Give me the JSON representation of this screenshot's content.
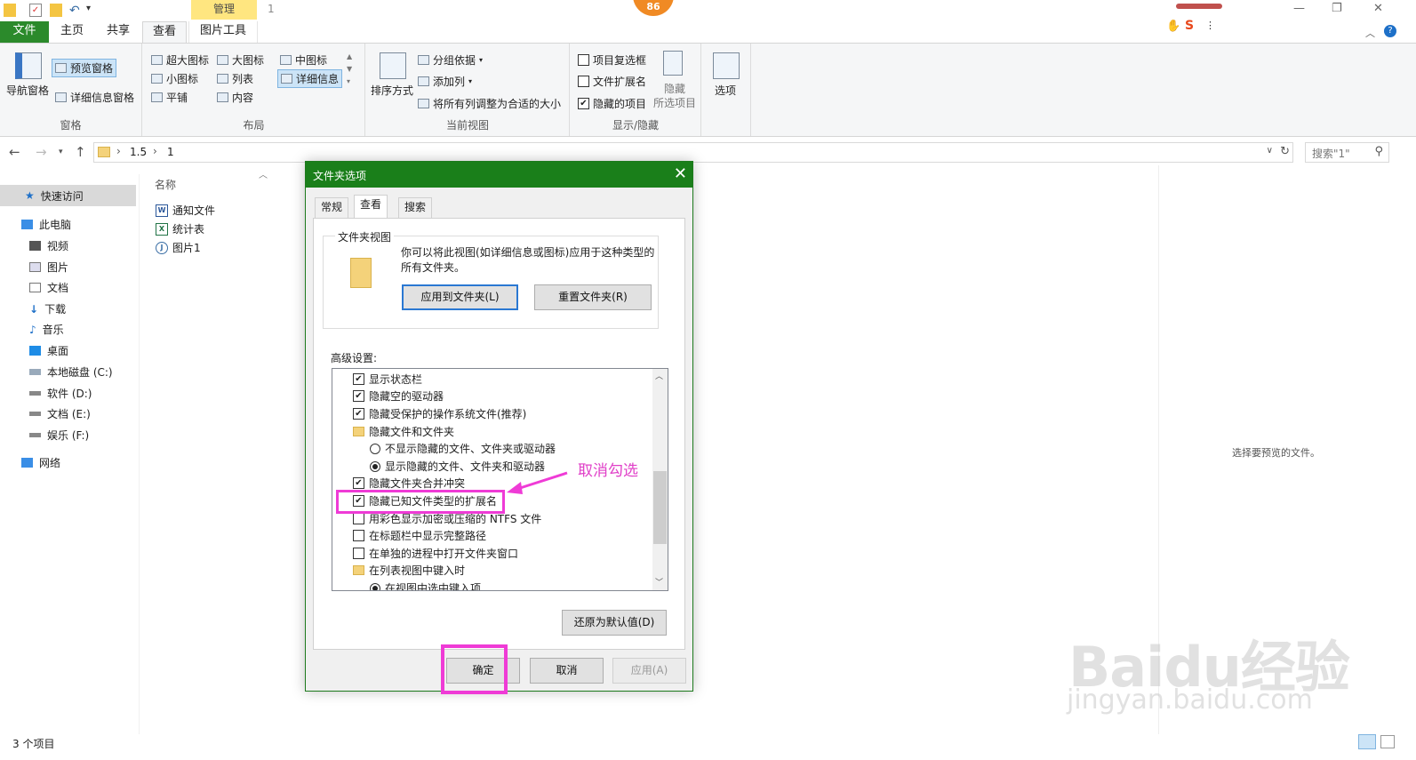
{
  "titlebar": {
    "manage_tab": "管理",
    "window_title": "1",
    "badge": "86",
    "minimize": "—",
    "maximize": "❐",
    "close": "✕"
  },
  "ribbon_tabs": {
    "file": "文件",
    "home": "主页",
    "share": "共享",
    "view": "查看",
    "picture_tools": "图片工具"
  },
  "ribbon": {
    "panes": {
      "label": "窗格",
      "nav_pane": "导航窗格",
      "preview_pane": "预览窗格",
      "details_pane": "详细信息窗格"
    },
    "layout": {
      "label": "布局",
      "extra_large": "超大图标",
      "large": "大图标",
      "medium": "中图标",
      "small": "小图标",
      "list": "列表",
      "details": "详细信息",
      "tiles": "平铺",
      "content": "内容"
    },
    "current_view": {
      "label": "当前视图",
      "sort_by": "排序方式",
      "group_by": "分组依据",
      "add_columns": "添加列",
      "fit_columns": "将所有列调整为合适的大小"
    },
    "show_hide": {
      "label": "显示/隐藏",
      "item_checkboxes": "项目复选框",
      "file_extensions": "文件扩展名",
      "hidden_items": "隐藏的项目",
      "hide_selected_1": "隐藏",
      "hide_selected_2": "所选项目"
    },
    "options": "选项"
  },
  "address": {
    "crumbs": [
      "1.5",
      "1"
    ],
    "search_placeholder": "搜索\"1\""
  },
  "nav": {
    "quick_access": "快速访问",
    "this_pc": "此电脑",
    "videos": "视频",
    "pictures": "图片",
    "documents": "文档",
    "downloads": "下载",
    "music": "音乐",
    "desktop": "桌面",
    "disk_c": "本地磁盘 (C:)",
    "disk_d": "软件 (D:)",
    "disk_e": "文档 (E:)",
    "disk_f": "娱乐 (F:)",
    "network": "网络"
  },
  "files": {
    "column_name": "名称",
    "items": [
      "通知文件",
      "统计表",
      "图片1"
    ]
  },
  "preview_hint": "选择要预览的文件。",
  "status": "3 个项目",
  "dialog": {
    "title": "文件夹选项",
    "tabs": [
      "常规",
      "查看",
      "搜索"
    ],
    "folder_views": {
      "legend": "文件夹视图",
      "description": "你可以将此视图(如详细信息或图标)应用于这种类型的所有文件夹。",
      "apply": "应用到文件夹(L)",
      "reset": "重置文件夹(R)"
    },
    "advanced_label": "高级设置:",
    "options": [
      "显示状态栏",
      "隐藏空的驱动器",
      "隐藏受保护的操作系统文件(推荐)",
      "隐藏文件和文件夹",
      "不显示隐藏的文件、文件夹或驱动器",
      "显示隐藏的文件、文件夹和驱动器",
      "隐藏文件夹合并冲突",
      "隐藏已知文件类型的扩展名",
      "用彩色显示加密或压缩的 NTFS 文件",
      "在标题栏中显示完整路径",
      "在单独的进程中打开文件夹窗口",
      "在列表视图中键入时",
      "在视图中选中键入项"
    ],
    "restore_defaults": "还原为默认值(D)",
    "ok": "确定",
    "cancel": "取消",
    "apply": "应用(A)"
  },
  "annotation": "取消勾选",
  "watermark": {
    "brand": "Baidu经验",
    "url": "jingyan.baidu.com"
  }
}
